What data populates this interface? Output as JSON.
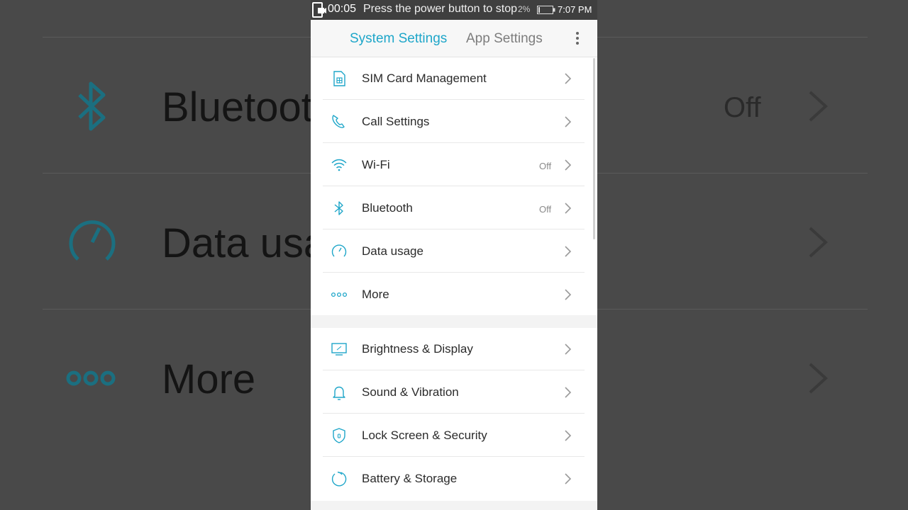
{
  "background": {
    "rows": [
      {
        "label": "Bluetoot",
        "value": "Off",
        "icon": "bluetooth-icon"
      },
      {
        "label": "Data usa",
        "value": "",
        "icon": "gauge-icon"
      },
      {
        "label": "More",
        "value": "",
        "icon": "dots-icon"
      }
    ]
  },
  "status_bar": {
    "timer": "00:05",
    "message": "Press the power button to stop",
    "battery_percent": "2%",
    "time": "7:07 PM"
  },
  "tabs": {
    "system": "System Settings",
    "app": "App Settings",
    "active": "system"
  },
  "group1": [
    {
      "label": "SIM Card Management",
      "value": "",
      "icon": "sim-card-icon"
    },
    {
      "label": "Call Settings",
      "value": "",
      "icon": "phone-icon"
    },
    {
      "label": "Wi-Fi",
      "value": "Off",
      "icon": "wifi-icon"
    },
    {
      "label": "Bluetooth",
      "value": "Off",
      "icon": "bluetooth-icon"
    },
    {
      "label": "Data usage",
      "value": "",
      "icon": "gauge-icon"
    },
    {
      "label": "More",
      "value": "",
      "icon": "dots-icon"
    }
  ],
  "group2": [
    {
      "label": "Brightness & Display",
      "value": "",
      "icon": "monitor-icon"
    },
    {
      "label": "Sound & Vibration",
      "value": "",
      "icon": "bell-icon"
    },
    {
      "label": "Lock Screen & Security",
      "value": "",
      "icon": "shield-icon"
    },
    {
      "label": "Battery & Storage",
      "value": "",
      "icon": "battery-storage-icon"
    }
  ],
  "colors": {
    "accent": "#1ea6c9",
    "text": "#2b2b2b",
    "muted": "#8a8a8a"
  }
}
